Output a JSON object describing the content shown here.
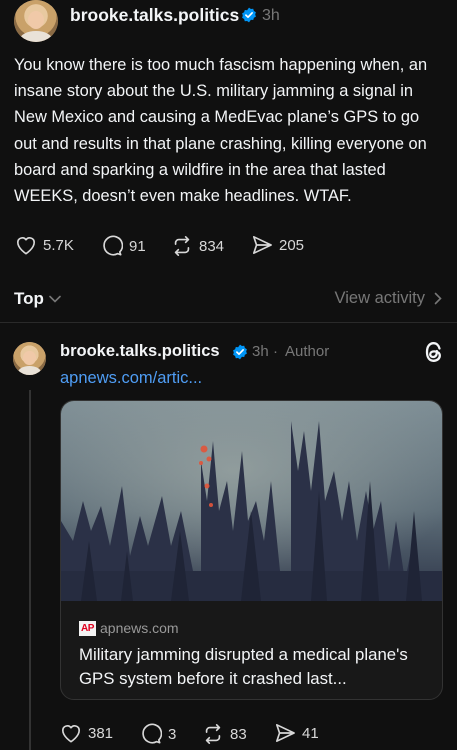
{
  "post": {
    "username": "brooke.talks.politics",
    "time": "3h",
    "text": "You know there is too much fascism happening when, an insane story about the U.S. military jamming a signal in New Mexico and causing a MedEvac plane’s GPS to go out and results in that plane crashing, killing everyone on board and sparking a wildfire in the area that lasted WEEKS, doesn’t even make headlines. WTAF.",
    "likes": "5.7K",
    "replies": "91",
    "reposts": "834",
    "shares": "205"
  },
  "sort": {
    "label": "Top",
    "view_activity": "View activity"
  },
  "reply": {
    "username": "brooke.talks.politics",
    "time": "3h",
    "author_tag": "Author",
    "link": "apnews.com/artic...",
    "card": {
      "source": "apnews.com",
      "source_logo": "AP",
      "title": "Military jamming disrupted a medical plane's GPS system before it crashed last..."
    },
    "likes": "381",
    "replies": "3",
    "reposts": "83",
    "shares": "41"
  },
  "colors": {
    "background": "#101010",
    "link": "#4f9df4",
    "verified": "#0095f6",
    "muted": "#777777"
  },
  "icons": [
    "heart-icon",
    "comment-icon",
    "repost-icon",
    "share-icon",
    "chevron-down-icon",
    "chevron-right-icon",
    "verified-icon",
    "threads-logo-icon"
  ]
}
